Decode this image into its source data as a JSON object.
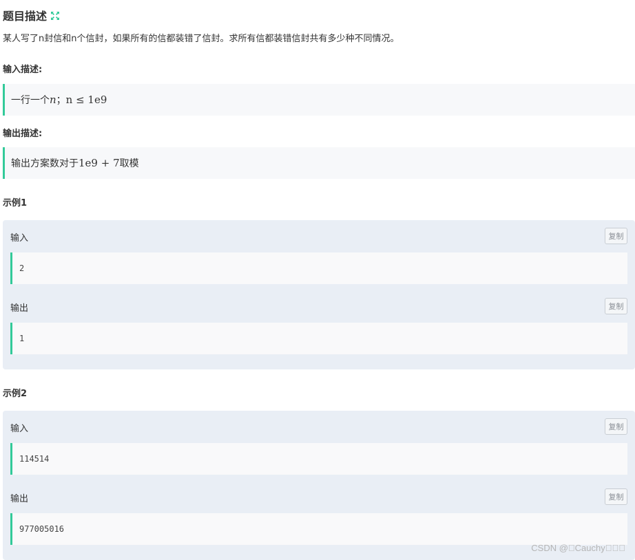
{
  "problem": {
    "title": "题目描述",
    "expand_icon": "expand-icon",
    "description": "某人写了n封信和n个信封，如果所有的信都装错了信封。求所有信都装错信封共有多少种不同情况。"
  },
  "input_section": {
    "label": "输入描述:",
    "text_prefix": "一行一个",
    "math_var": "n",
    "text_sep": "；",
    "math_expr": "n ≤ 1e9"
  },
  "output_section": {
    "label": "输出描述:",
    "text_prefix": "输出方案数对于",
    "math_expr": "1e9 + 7",
    "text_suffix": "取模"
  },
  "examples": [
    {
      "title": "示例1",
      "input_label": "输入",
      "input_value": "2",
      "output_label": "输出",
      "output_value": "1",
      "copy_label": "复制"
    },
    {
      "title": "示例2",
      "input_label": "输入",
      "input_value": "114514",
      "output_label": "输出",
      "output_value": "977005016",
      "copy_label": "复制"
    }
  ],
  "watermark": "CSDN @\u0000Cauchy\u0000\u0000\u0000",
  "colors": {
    "accent": "#32ca99",
    "example_bg": "#e9eef5",
    "quote_bg": "#f7f8fa"
  }
}
